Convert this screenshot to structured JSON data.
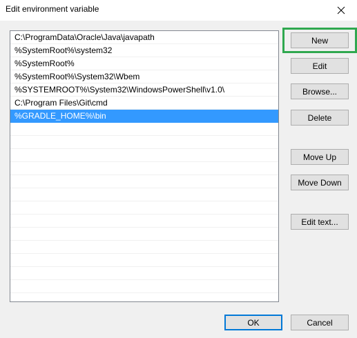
{
  "window": {
    "title": "Edit environment variable",
    "close_icon": "close-icon"
  },
  "colors": {
    "selection": "#3399ff",
    "highlight_frame": "#2fa84f",
    "focus_border": "#0078d7"
  },
  "list": {
    "items": [
      "C:\\ProgramData\\Oracle\\Java\\javapath",
      "%SystemRoot%\\system32",
      "%SystemRoot%",
      "%SystemRoot%\\System32\\Wbem",
      "%SYSTEMROOT%\\System32\\WindowsPowerShell\\v1.0\\",
      "C:\\Program Files\\Git\\cmd",
      "%GRADLE_HOME%\\bin"
    ],
    "selected_index": 6
  },
  "buttons": {
    "new": "New",
    "edit": "Edit",
    "browse": "Browse...",
    "delete": "Delete",
    "move_up": "Move Up",
    "move_down": "Move Down",
    "edit_text": "Edit text...",
    "ok": "OK",
    "cancel": "Cancel"
  }
}
